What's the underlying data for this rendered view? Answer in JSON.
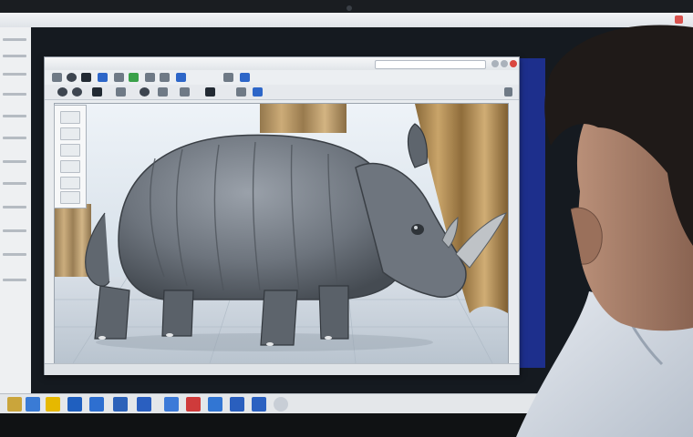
{
  "colors": {
    "accent_blue": "#1d2f8c",
    "close_red": "#d9463f",
    "rhino_gray": "#6f7680"
  },
  "editor": {
    "tab_title": "",
    "toolbar_label": "",
    "icon_names": [
      "save-icon",
      "undo-icon",
      "brush-icon",
      "eraser-icon",
      "zoom-icon",
      "layers-icon"
    ]
  },
  "canvas": {
    "subject": ""
  },
  "taskbar": {
    "icons": [
      "file-explorer-icon",
      "app-icon-blue",
      "app-icon-k",
      "app-icon-red",
      "app-icon-blue-2",
      "app-icon-b",
      "app-icon-blue-3",
      "app-icon-circle"
    ]
  }
}
